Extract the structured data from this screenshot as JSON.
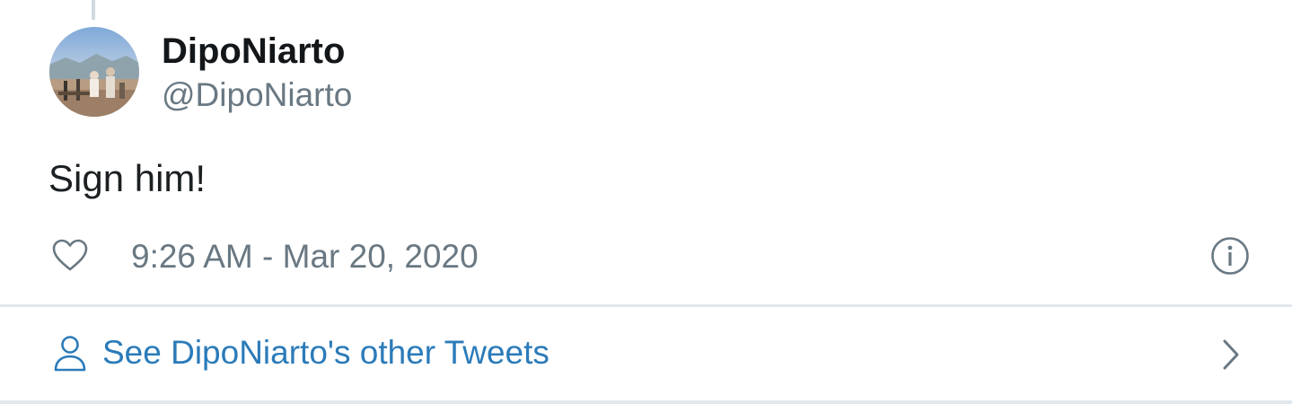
{
  "tweet": {
    "author": {
      "display_name": "DipoNiarto",
      "handle": "@DipoNiarto"
    },
    "text": "Sign him!",
    "timestamp": "9:26 AM - Mar 20, 2020",
    "like_icon": "heart-icon",
    "info_icon": "info-icon"
  },
  "footer": {
    "other_tweets_label": "See DipoNiarto's other Tweets",
    "person_icon": "person-icon",
    "chevron_icon": "chevron-right-icon"
  },
  "colors": {
    "text_primary": "#14171a",
    "text_secondary": "#697882",
    "link": "#2b7bb9",
    "border": "#e1e8ed"
  }
}
